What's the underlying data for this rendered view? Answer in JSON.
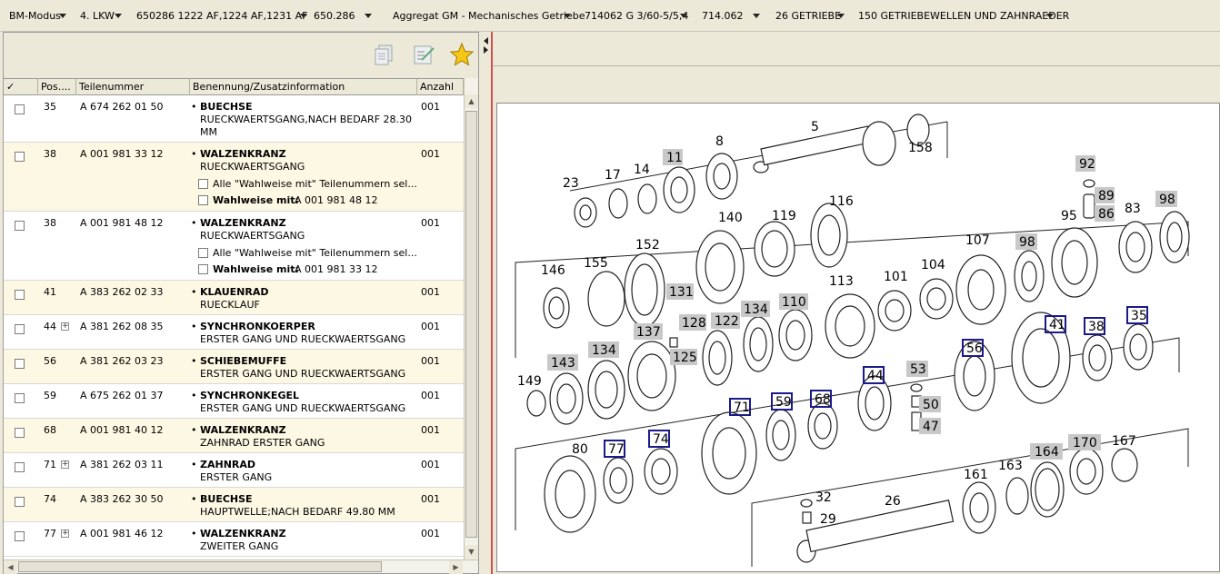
{
  "topbar": {
    "items": [
      {
        "label": "BM-Modus"
      },
      {
        "label": "4. LKW"
      },
      {
        "label": "650286 1222 AF,1224 AF,1231 AF"
      },
      {
        "label": "650.286"
      },
      {
        "label": "Aggregat GM - Mechanisches Getriebe"
      },
      {
        "label": "714062 G 3/60-5/5,4"
      },
      {
        "label": "714.062"
      },
      {
        "label": "26 GETRIEBE"
      },
      {
        "label": "150 GETRIEBEWELLEN UND ZAHNRAEDER"
      }
    ]
  },
  "toolbar": {
    "icons": [
      "copy-icon",
      "edit-list-icon",
      "star-icon"
    ]
  },
  "grid": {
    "headers": {
      "check": "✓",
      "pos": "Pos....",
      "part": "Teilenummer",
      "desc": "Benennung/Zusatzinformation",
      "qty": "Anzahl"
    },
    "rows": [
      {
        "pos": "35",
        "part": "A 674 262 01 50",
        "name": "BUECHSE",
        "info1": "RUECKWAERTSGANG,NACH BEDARF 28.30",
        "info2": "MM",
        "qty": "001"
      },
      {
        "pos": "38",
        "part": "A 001 981 33 12",
        "name": "WALZENKRANZ",
        "info1": "RUECKWAERTSGANG",
        "alt_all": "Alle \"Wahlweise mit\" Teilenummern sel...",
        "alt_label": "Wahlweise mit:",
        "alt_part": "A 001 981 48 12",
        "qty": "001"
      },
      {
        "pos": "38",
        "part": "A 001 981 48 12",
        "name": "WALZENKRANZ",
        "info1": "RUECKWAERTSGANG",
        "alt_all": "Alle \"Wahlweise mit\" Teilenummern sel...",
        "alt_label": "Wahlweise mit:",
        "alt_part": "A 001 981 33 12",
        "qty": "001"
      },
      {
        "pos": "41",
        "part": "A 383 262 02 33",
        "name": "KLAUENRAD",
        "info1": "RUECKLAUF",
        "qty": "001"
      },
      {
        "pos": "44",
        "part": "A 381 262 08 35",
        "name": "SYNCHRONKOERPER",
        "info1": "ERSTER GANG UND RUECKWAERTSGANG",
        "qty": "001"
      },
      {
        "pos": "56",
        "part": "A 381 262 03 23",
        "name": "SCHIEBEMUFFE",
        "info1": "ERSTER GANG UND RUECKWAERTSGANG",
        "qty": "001"
      },
      {
        "pos": "59",
        "part": "A 675 262 01 37",
        "name": "SYNCHRONKEGEL",
        "info1": "ERSTER GANG UND RUECKWAERTSGANG",
        "qty": "001"
      },
      {
        "pos": "68",
        "part": "A 001 981 40 12",
        "name": "WALZENKRANZ",
        "info1": "ZAHNRAD ERSTER GANG",
        "qty": "001"
      },
      {
        "pos": "71",
        "part": "A 381 262 03 11",
        "name": "ZAHNRAD",
        "info1": "ERSTER GANG",
        "qty": "001"
      },
      {
        "pos": "74",
        "part": "A 383 262 30 50",
        "name": "BUECHSE",
        "info1": "HAUPTWELLE;NACH BEDARF 49.80 MM",
        "qty": "001"
      },
      {
        "pos": "77",
        "part": "A 001 981 46 12",
        "name": "WALZENKRANZ",
        "info1": "ZWEITER GANG",
        "qty": "001"
      }
    ]
  },
  "drawing": {
    "labels_plain": [
      "5",
      "8",
      "158",
      "23",
      "17",
      "14",
      "140",
      "119",
      "116",
      "107",
      "95",
      "83",
      "146",
      "155",
      "152",
      "113",
      "101",
      "104",
      "149",
      "80",
      "26",
      "161",
      "163",
      "167",
      "32",
      "29"
    ],
    "labels_gray": [
      "11",
      "92",
      "89",
      "86",
      "98",
      "98",
      "131",
      "128",
      "122",
      "134",
      "110",
      "137",
      "125",
      "143",
      "134",
      "53",
      "50",
      "47",
      "164",
      "170"
    ],
    "labels_blue": [
      "41",
      "38",
      "35",
      "56",
      "44",
      "71",
      "59",
      "68",
      "77",
      "74"
    ]
  }
}
